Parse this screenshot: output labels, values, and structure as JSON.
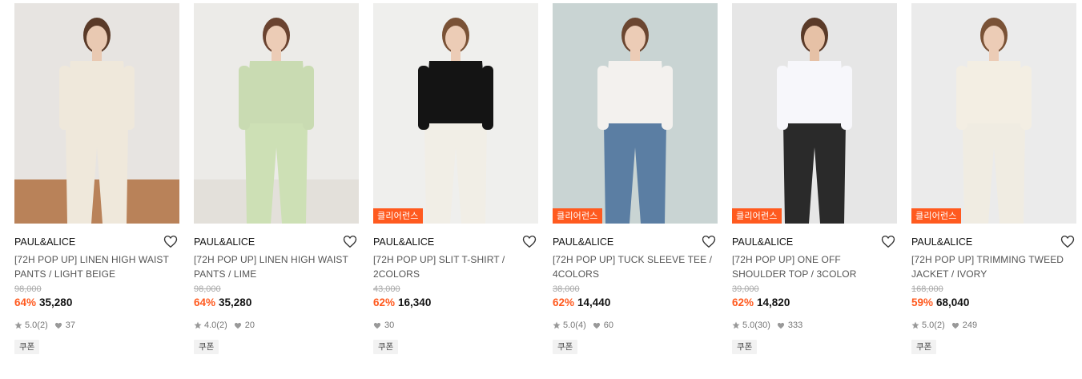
{
  "products": [
    {
      "brand": "PAUL&ALICE",
      "name_line1": "[72H POP UP] LINEN HIGH WAIST",
      "name_line2": "PANTS / LIGHT BEIGE",
      "original_price": "98,000",
      "discount": "64%",
      "price": "35,280",
      "rating": "5.0",
      "reviews": "(2)",
      "likes": "37",
      "coupon": "쿠폰",
      "badge": "",
      "bg": "#e7e4e1",
      "floor": "#b98259",
      "outfit": "#efe8db",
      "top": "#efe8db",
      "skin": "#e9c9b2",
      "hair": "#5a3a28"
    },
    {
      "brand": "PAUL&ALICE",
      "name_line1": "[72H POP UP] LINEN HIGH WAIST",
      "name_line2": "PANTS / LIME",
      "original_price": "98,000",
      "discount": "64%",
      "price": "35,280",
      "rating": "4.0",
      "reviews": "(2)",
      "likes": "20",
      "coupon": "쿠폰",
      "badge": "",
      "bg": "#ecebe8",
      "floor": "#e3e0da",
      "outfit": "#cde0b5",
      "top": "#c9dbb2",
      "skin": "#ecccb6",
      "hair": "#6a4330"
    },
    {
      "brand": "PAUL&ALICE",
      "name_line1": "[72H POP UP] SLIT T-SHIRT /",
      "name_line2": "2COLORS",
      "original_price": "43,000",
      "discount": "62%",
      "price": "16,340",
      "rating": "",
      "reviews": "",
      "likes": "30",
      "coupon": "쿠폰",
      "badge": "클리어런스",
      "bg": "#efefed",
      "floor": "#efefed",
      "outfit": "#f1eee6",
      "top": "#141414",
      "skin": "#ecccb6",
      "hair": "#7a5236"
    },
    {
      "brand": "PAUL&ALICE",
      "name_line1": "[72H POP UP] TUCK SLEEVE TEE /",
      "name_line2": "4COLORS",
      "original_price": "38,000",
      "discount": "62%",
      "price": "14,440",
      "rating": "5.0",
      "reviews": "(4)",
      "likes": "60",
      "coupon": "쿠폰",
      "badge": "클리어런스",
      "bg": "#c9d4d3",
      "floor": "#c9d4d3",
      "outfit": "#5b7ea3",
      "top": "#f3f1ee",
      "skin": "#ecccb6",
      "hair": "#6b4630"
    },
    {
      "brand": "PAUL&ALICE",
      "name_line1": "[72H POP UP] ONE OFF",
      "name_line2": "SHOULDER TOP / 3COLOR",
      "original_price": "39,000",
      "discount": "62%",
      "price": "14,820",
      "rating": "5.0",
      "reviews": "(30)",
      "likes": "333",
      "coupon": "쿠폰",
      "badge": "클리어런스",
      "bg": "#e6e6e6",
      "floor": "#e6e6e6",
      "outfit": "#2a2a2a",
      "top": "#f7f7fb",
      "skin": "#e6c1a6",
      "hair": "#5a3a28"
    },
    {
      "brand": "PAUL&ALICE",
      "name_line1": "[72H POP UP] TRIMMING TWEED",
      "name_line2": "JACKET / IVORY",
      "original_price": "168,000",
      "discount": "59%",
      "price": "68,040",
      "rating": "5.0",
      "reviews": "(2)",
      "likes": "249",
      "coupon": "쿠폰",
      "badge": "클리어런스",
      "bg": "#ebebeb",
      "floor": "#ebebeb",
      "outfit": "#f0ece2",
      "top": "#f3eee3",
      "skin": "#ecccb6",
      "hair": "#7a5236"
    }
  ],
  "colors": {
    "accent": "#ff5a1f",
    "muted": "#777777"
  }
}
